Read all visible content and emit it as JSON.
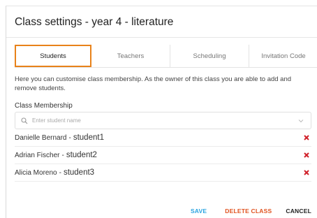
{
  "dialog": {
    "title": "Class settings - year 4 - literature"
  },
  "tabs": [
    {
      "label": "Students",
      "active": true
    },
    {
      "label": "Teachers",
      "active": false
    },
    {
      "label": "Scheduling",
      "active": false
    },
    {
      "label": "Invitation Code",
      "active": false
    }
  ],
  "description": "Here you can customise class membership. As the owner of this class you are able to add and remove students.",
  "membership": {
    "label": "Class Membership",
    "search_placeholder": "Enter student name",
    "members": [
      {
        "name": "Danielle Bernard",
        "username": "student1"
      },
      {
        "name": "Adrian Fischer",
        "username": "student2"
      },
      {
        "name": "Alicia Moreno",
        "username": "student3"
      }
    ]
  },
  "actions": {
    "save": "SAVE",
    "delete": "DELETE CLASS",
    "cancel": "CANCEL"
  },
  "colors": {
    "active_tab_outline": "#e8821a",
    "save": "#2aa4e0",
    "delete": "#e0521f",
    "remove_icon": "#d0202a"
  }
}
